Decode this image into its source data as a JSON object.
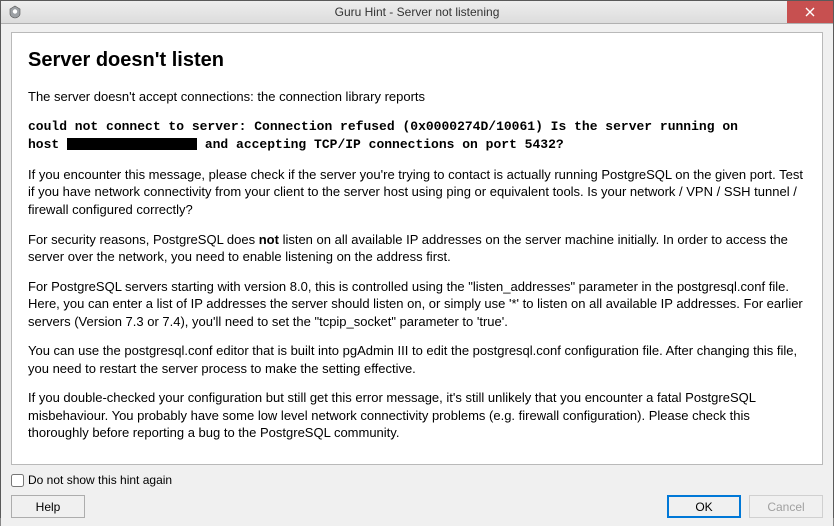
{
  "window": {
    "title": "Guru Hint - Server not listening"
  },
  "content": {
    "heading": "Server doesn't listen",
    "p1": "The server doesn't accept connections: the connection library reports",
    "err_line1_a": "could not connect to server: Connection refused (0x0000274D/10061) Is the server running on",
    "err_line2_a": "host ",
    "err_line2_b": " and accepting TCP/IP connections on port 5432?",
    "p3": "If you encounter this message, please check if the server you're trying to contact is actually running PostgreSQL on the given port. Test if you have network connectivity from your client to the server host using ping or equivalent tools. Is your network / VPN / SSH tunnel / firewall configured correctly?",
    "p4_a": "For security reasons, PostgreSQL does ",
    "p4_not": "not",
    "p4_b": " listen on all available IP addresses on the server machine initially. In order to access the server over the network, you need to enable listening on the address first.",
    "p5": "For PostgreSQL servers starting with version 8.0, this is controlled using the \"listen_addresses\" parameter in the postgresql.conf file. Here, you can enter a list of IP addresses the server should listen on, or simply use '*' to listen on all available IP addresses. For earlier servers (Version 7.3 or 7.4), you'll need to set the \"tcpip_socket\" parameter to 'true'.",
    "p6": "You can use the postgresql.conf editor that is built into pgAdmin III to edit the postgresql.conf configuration file. After changing this file, you need to restart the server process to make the setting effective.",
    "p7": "If you double-checked your configuration but still get this error message, it's still unlikely that you encounter a fatal PostgreSQL misbehaviour. You probably have some low level network connectivity problems (e.g. firewall configuration). Please check this thoroughly before reporting a bug to the PostgreSQL community."
  },
  "footer": {
    "checkbox_label": "Do not show this hint again",
    "help": "Help",
    "ok": "OK",
    "cancel": "Cancel"
  }
}
